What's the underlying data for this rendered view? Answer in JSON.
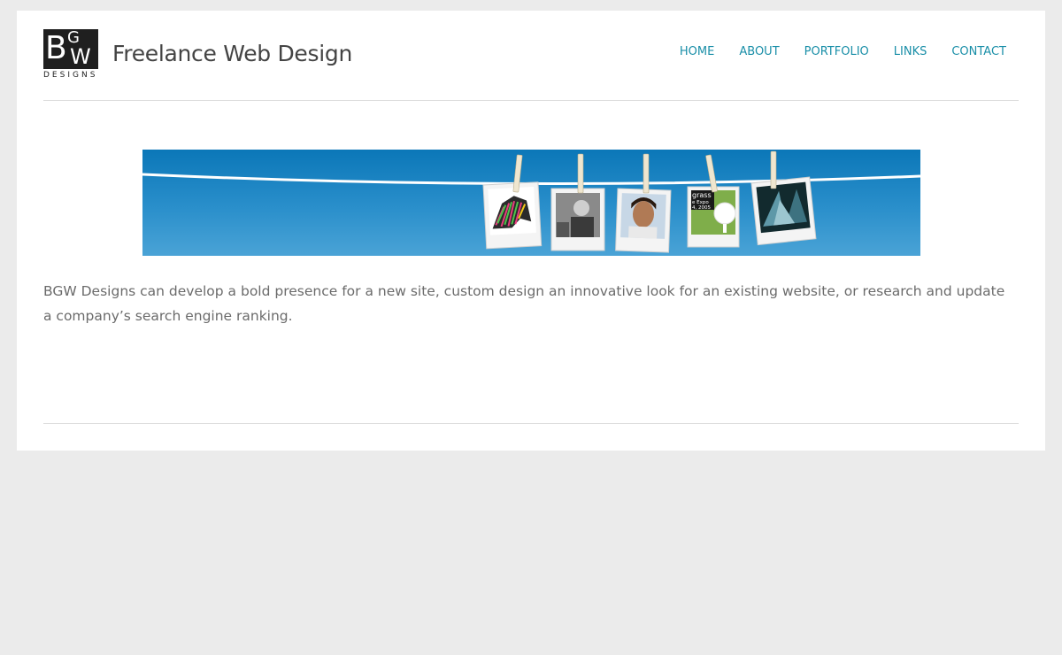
{
  "site": {
    "logo": {
      "letter_b": "B",
      "letter_g": "G",
      "letter_w": "W",
      "subtitle": "DESIGNS"
    },
    "title": "Freelance Web Design"
  },
  "nav": {
    "items": [
      {
        "label": "HOME"
      },
      {
        "label": "ABOUT"
      },
      {
        "label": "PORTFOLIO"
      },
      {
        "label": "LINKS"
      },
      {
        "label": "CONTACT"
      }
    ]
  },
  "banner": {
    "photo_text_1": "grass",
    "photo_text_2": "e Expo",
    "photo_text_3": "4, 2005"
  },
  "content": {
    "intro": "BGW Designs can develop a bold presence for a new site, custom design an innovative look for an existing website, or research and update a company’s search engine ranking."
  },
  "colors": {
    "background": "#ebebeb",
    "link": "#1a8fa8",
    "text": "#6b6b6b",
    "banner_blue": "#0b77b8"
  }
}
